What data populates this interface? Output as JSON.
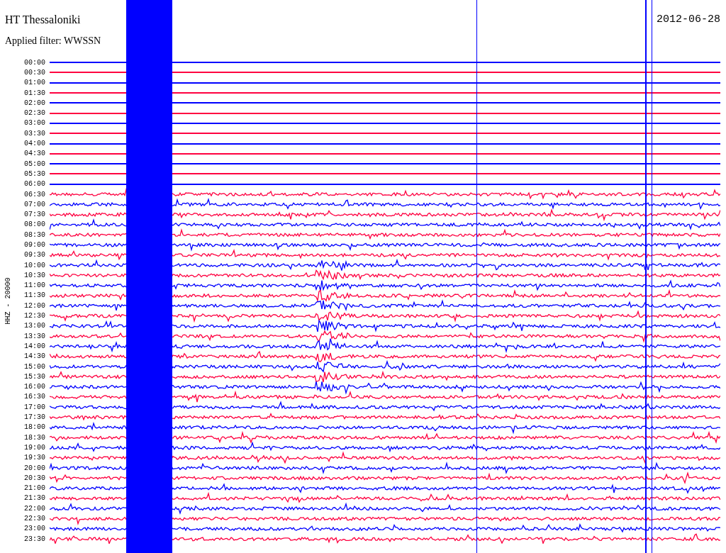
{
  "header": {
    "station": "HT Thessaloniki",
    "date": "2012-06-28",
    "filter": "Applied filter: WWSSN"
  },
  "channel_label": "HHZ - 20000",
  "rows": [
    {
      "time": "00:00",
      "color": "#0000ff",
      "kind": "flat"
    },
    {
      "time": "00:30",
      "color": "#ff0040",
      "kind": "flat"
    },
    {
      "time": "01:00",
      "color": "#0000ff",
      "kind": "flat"
    },
    {
      "time": "01:30",
      "color": "#ff0040",
      "kind": "flat"
    },
    {
      "time": "02:00",
      "color": "#0000ff",
      "kind": "flat"
    },
    {
      "time": "02:30",
      "color": "#ff0040",
      "kind": "flat"
    },
    {
      "time": "03:00",
      "color": "#0000ff",
      "kind": "flat"
    },
    {
      "time": "03:30",
      "color": "#ff0040",
      "kind": "flat"
    },
    {
      "time": "04:00",
      "color": "#0000ff",
      "kind": "flat"
    },
    {
      "time": "04:30",
      "color": "#ff0040",
      "kind": "flat"
    },
    {
      "time": "05:00",
      "color": "#0000ff",
      "kind": "flat"
    },
    {
      "time": "05:30",
      "color": "#ff0040",
      "kind": "flat"
    },
    {
      "time": "06:00",
      "color": "#0000ff",
      "kind": "flat"
    },
    {
      "time": "06:30",
      "color": "#ff0040",
      "kind": "noisy"
    },
    {
      "time": "07:00",
      "color": "#0000ff",
      "kind": "noisy"
    },
    {
      "time": "07:30",
      "color": "#ff0040",
      "kind": "noisy"
    },
    {
      "time": "08:00",
      "color": "#0000ff",
      "kind": "noisy"
    },
    {
      "time": "08:30",
      "color": "#ff0040",
      "kind": "noisy"
    },
    {
      "time": "09:00",
      "color": "#0000ff",
      "kind": "noisy"
    },
    {
      "time": "09:30",
      "color": "#ff0040",
      "kind": "noisy"
    },
    {
      "time": "10:00",
      "color": "#0000ff",
      "kind": "noisy"
    },
    {
      "time": "10:30",
      "color": "#ff0040",
      "kind": "noisy"
    },
    {
      "time": "11:00",
      "color": "#0000ff",
      "kind": "noisy"
    },
    {
      "time": "11:30",
      "color": "#ff0040",
      "kind": "noisy"
    },
    {
      "time": "12:00",
      "color": "#0000ff",
      "kind": "noisy"
    },
    {
      "time": "12:30",
      "color": "#ff0040",
      "kind": "noisy"
    },
    {
      "time": "13:00",
      "color": "#0000ff",
      "kind": "noisy"
    },
    {
      "time": "13:30",
      "color": "#ff0040",
      "kind": "noisy"
    },
    {
      "time": "14:00",
      "color": "#0000ff",
      "kind": "noisy"
    },
    {
      "time": "14:30",
      "color": "#ff0040",
      "kind": "noisy"
    },
    {
      "time": "15:00",
      "color": "#0000ff",
      "kind": "noisy"
    },
    {
      "time": "15:30",
      "color": "#ff0040",
      "kind": "noisy"
    },
    {
      "time": "16:00",
      "color": "#0000ff",
      "kind": "noisy"
    },
    {
      "time": "16:30",
      "color": "#ff0040",
      "kind": "noisy"
    },
    {
      "time": "17:00",
      "color": "#0000ff",
      "kind": "noisy"
    },
    {
      "time": "17:30",
      "color": "#ff0040",
      "kind": "noisy"
    },
    {
      "time": "18:00",
      "color": "#0000ff",
      "kind": "noisy"
    },
    {
      "time": "18:30",
      "color": "#ff0040",
      "kind": "noisy"
    },
    {
      "time": "19:00",
      "color": "#0000ff",
      "kind": "noisy"
    },
    {
      "time": "19:30",
      "color": "#ff0040",
      "kind": "noisy"
    },
    {
      "time": "20:00",
      "color": "#0000ff",
      "kind": "noisy"
    },
    {
      "time": "20:30",
      "color": "#ff0040",
      "kind": "noisy"
    },
    {
      "time": "21:00",
      "color": "#0000ff",
      "kind": "noisy"
    },
    {
      "time": "21:30",
      "color": "#ff0040",
      "kind": "noisy"
    },
    {
      "time": "22:00",
      "color": "#0000ff",
      "kind": "noisy"
    },
    {
      "time": "22:30",
      "color": "#ff0040",
      "kind": "noisy"
    },
    {
      "time": "23:00",
      "color": "#0000ff",
      "kind": "noisy"
    },
    {
      "time": "23:30",
      "color": "#ff0040",
      "kind": "noisy"
    }
  ]
}
